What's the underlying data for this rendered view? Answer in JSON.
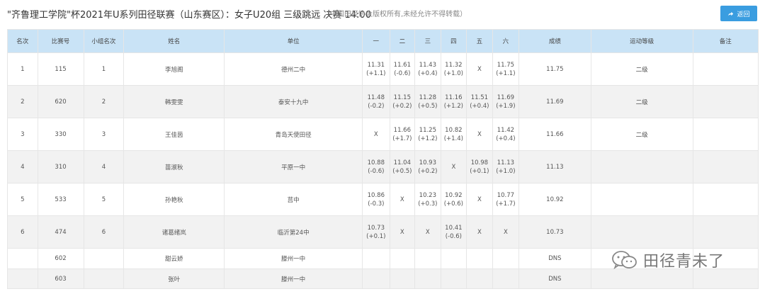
{
  "header": {
    "title": "\"齐鲁理工学院\"杯2021年U系列田径联赛（山东赛区）：女子U20组 三级跳远 决赛  14:00",
    "copyright": "（中国田径协会版权所有,未经允许不得转载）",
    "back_label": "返回"
  },
  "table": {
    "columns": [
      "名次",
      "比赛号",
      "小组名次",
      "姓名",
      "单位",
      "一",
      "二",
      "三",
      "四",
      "五",
      "六",
      "成绩",
      "运动等级",
      "备注"
    ],
    "rows": [
      {
        "rank": "1",
        "bib": "115",
        "group_rank": "1",
        "name": "李旭阁",
        "unit": "德州二中",
        "trials": [
          {
            "v": "11.31",
            "w": "(+1.1)"
          },
          {
            "v": "11.61",
            "w": "(-0.6)"
          },
          {
            "v": "11.43",
            "w": "(+0.4)"
          },
          {
            "v": "11.32",
            "w": "(+1.0)"
          },
          {
            "v": "X",
            "w": ""
          },
          {
            "v": "11.75",
            "w": "(+1.1)"
          }
        ],
        "result": "11.75",
        "level": "二级",
        "note": ""
      },
      {
        "rank": "2",
        "bib": "620",
        "group_rank": "2",
        "name": "韩雯雯",
        "unit": "泰安十九中",
        "trials": [
          {
            "v": "11.48",
            "w": "(-0.2)"
          },
          {
            "v": "11.15",
            "w": "(+0.2)"
          },
          {
            "v": "11.28",
            "w": "(+0.5)"
          },
          {
            "v": "11.16",
            "w": "(+1.2)"
          },
          {
            "v": "11.51",
            "w": "(+0.4)"
          },
          {
            "v": "11.69",
            "w": "(+1.9)"
          }
        ],
        "result": "11.69",
        "level": "二级",
        "note": ""
      },
      {
        "rank": "3",
        "bib": "330",
        "group_rank": "3",
        "name": "王佳茵",
        "unit": "青岛天使田径",
        "trials": [
          {
            "v": "X",
            "w": ""
          },
          {
            "v": "11.66",
            "w": "(+1.7)"
          },
          {
            "v": "11.25",
            "w": "(+1.2)"
          },
          {
            "v": "10.82",
            "w": "(+1.4)"
          },
          {
            "v": "X",
            "w": ""
          },
          {
            "v": "11.42",
            "w": "(+0.4)"
          }
        ],
        "result": "11.66",
        "level": "二级",
        "note": ""
      },
      {
        "rank": "4",
        "bib": "310",
        "group_rank": "4",
        "name": "苗淑秋",
        "unit": "平原一中",
        "trials": [
          {
            "v": "10.88",
            "w": "(-0.6)"
          },
          {
            "v": "11.04",
            "w": "(+0.5)"
          },
          {
            "v": "10.93",
            "w": "(+0.2)"
          },
          {
            "v": "X",
            "w": ""
          },
          {
            "v": "10.98",
            "w": "(+0.1)"
          },
          {
            "v": "11.13",
            "w": "(+1.0)"
          }
        ],
        "result": "11.13",
        "level": "",
        "note": ""
      },
      {
        "rank": "5",
        "bib": "533",
        "group_rank": "5",
        "name": "孙艳秋",
        "unit": "莒中",
        "trials": [
          {
            "v": "10.86",
            "w": "(-0.3)"
          },
          {
            "v": "X",
            "w": ""
          },
          {
            "v": "10.23",
            "w": "(+0.3)"
          },
          {
            "v": "10.92",
            "w": "(+0.6)"
          },
          {
            "v": "X",
            "w": ""
          },
          {
            "v": "10.77",
            "w": "(+1.7)"
          }
        ],
        "result": "10.92",
        "level": "",
        "note": ""
      },
      {
        "rank": "6",
        "bib": "474",
        "group_rank": "6",
        "name": "诸葛绪岚",
        "unit": "临沂第24中",
        "trials": [
          {
            "v": "10.73",
            "w": "(+0.1)"
          },
          {
            "v": "X",
            "w": ""
          },
          {
            "v": "X",
            "w": ""
          },
          {
            "v": "10.41",
            "w": "(-0.6)"
          },
          {
            "v": "X",
            "w": ""
          },
          {
            "v": "X",
            "w": ""
          }
        ],
        "result": "10.73",
        "level": "",
        "note": ""
      },
      {
        "rank": "",
        "bib": "602",
        "group_rank": "",
        "name": "甜云娇",
        "unit": "滕州一中",
        "trials": [
          {
            "v": "",
            "w": ""
          },
          {
            "v": "",
            "w": ""
          },
          {
            "v": "",
            "w": ""
          },
          {
            "v": "",
            "w": ""
          },
          {
            "v": "",
            "w": ""
          },
          {
            "v": "",
            "w": ""
          }
        ],
        "result": "DNS",
        "level": "",
        "note": ""
      },
      {
        "rank": "",
        "bib": "603",
        "group_rank": "",
        "name": "张叶",
        "unit": "滕州一中",
        "trials": [
          {
            "v": "",
            "w": ""
          },
          {
            "v": "",
            "w": ""
          },
          {
            "v": "",
            "w": ""
          },
          {
            "v": "",
            "w": ""
          },
          {
            "v": "",
            "w": ""
          },
          {
            "v": "",
            "w": ""
          }
        ],
        "result": "DNS",
        "level": "",
        "note": ""
      }
    ]
  },
  "watermark": {
    "text": "田径青未了",
    "icon": "wechat-logo-icon"
  },
  "colors": {
    "header_bg": "#c9e3f6",
    "button_bg": "#3a9de0",
    "row_alt": "#f2f2f2"
  }
}
